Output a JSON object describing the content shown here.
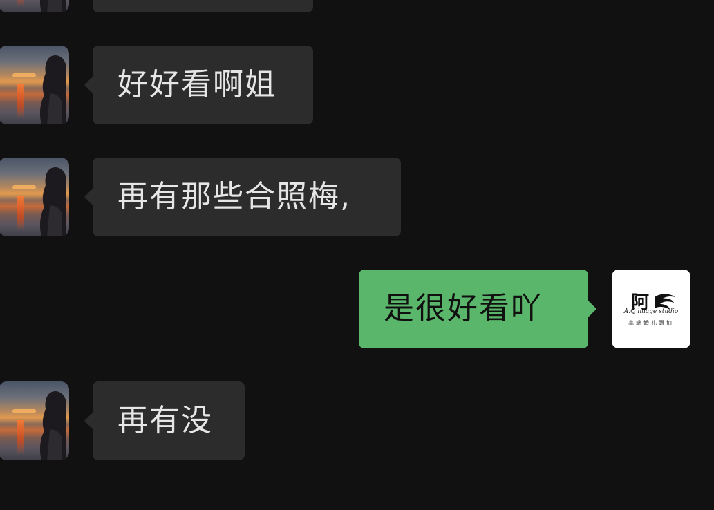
{
  "messages": [
    {
      "side": "incoming",
      "text": ""
    },
    {
      "side": "incoming",
      "text": "好好看啊姐"
    },
    {
      "side": "incoming",
      "text": "再有那些合照梅,"
    },
    {
      "side": "outgoing",
      "text": "是很好看吖"
    },
    {
      "side": "incoming",
      "text": "再有没"
    }
  ],
  "self_avatar": {
    "logo_char": "阿",
    "studio_name": "A.Q image studio",
    "subtitle": "高端婚礼跟拍"
  },
  "colors": {
    "background": "#111111",
    "incoming_bubble": "#2c2c2c",
    "outgoing_bubble": "#5ab66a",
    "incoming_text": "#e6e6e6",
    "outgoing_text": "#101010"
  },
  "icons": {
    "contact_avatar": "sunset-portrait-avatar",
    "self_avatar": "studio-logo-avatar"
  }
}
